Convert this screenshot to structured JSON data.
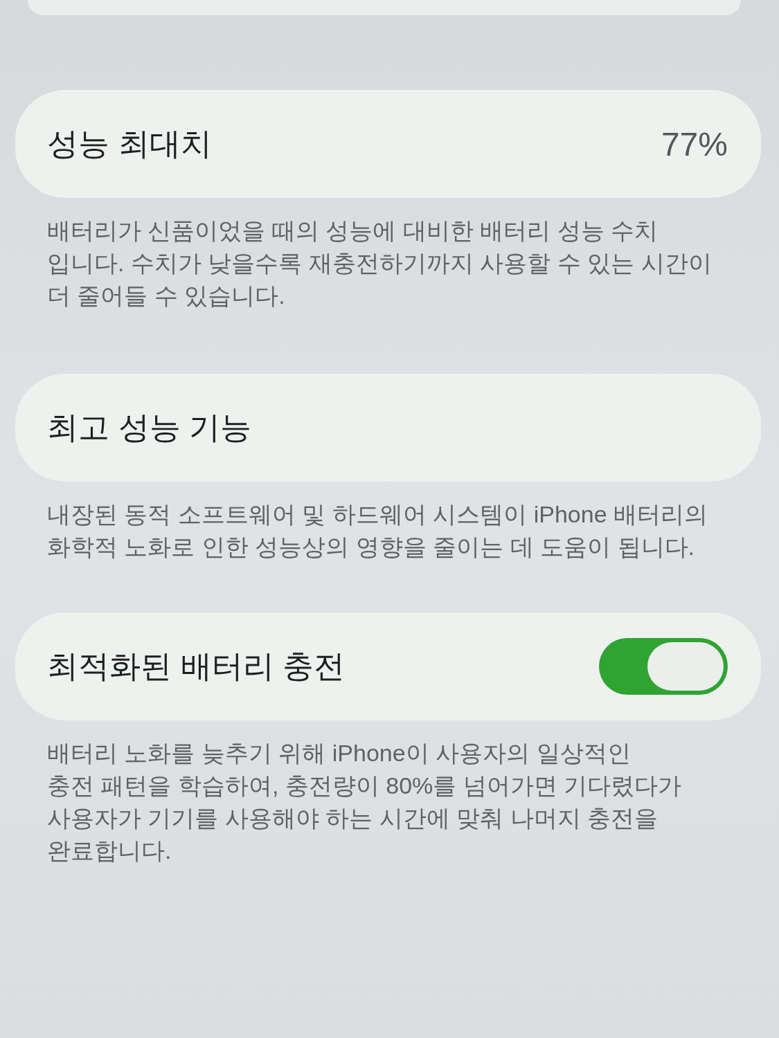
{
  "sections": [
    {
      "kind": "value",
      "title": "성능 최대치",
      "value": "77%",
      "footer": "배터리가 신품이었을 때의 성능에 대비한 배터리 성능 수치\n입니다. 수치가 낮을수록 재충전하기까지 사용할 수 있는 시간이\n더 줄어들 수 있습니다."
    },
    {
      "kind": "plain",
      "title": "최고 성능 기능",
      "footer": "내장된 동적 소프트웨어 및 하드웨어 시스템이 iPhone 배터리의\n화학적 노화로 인한 성능상의 영향을 줄이는 데 도움이 됩니다."
    },
    {
      "kind": "toggle",
      "title": "최적화된 배터리 충전",
      "on": true,
      "footer": "배터리 노화를 늦추기 위해 iPhone이 사용자의 일상적인\n충전 패턴을 학습하여, 충전량이 80%를 넘어가면 기다렸다가\n사용자가 기기를 사용해야 하는 시간에 맞춰 나머지 충전을\n완료합니다."
    }
  ]
}
